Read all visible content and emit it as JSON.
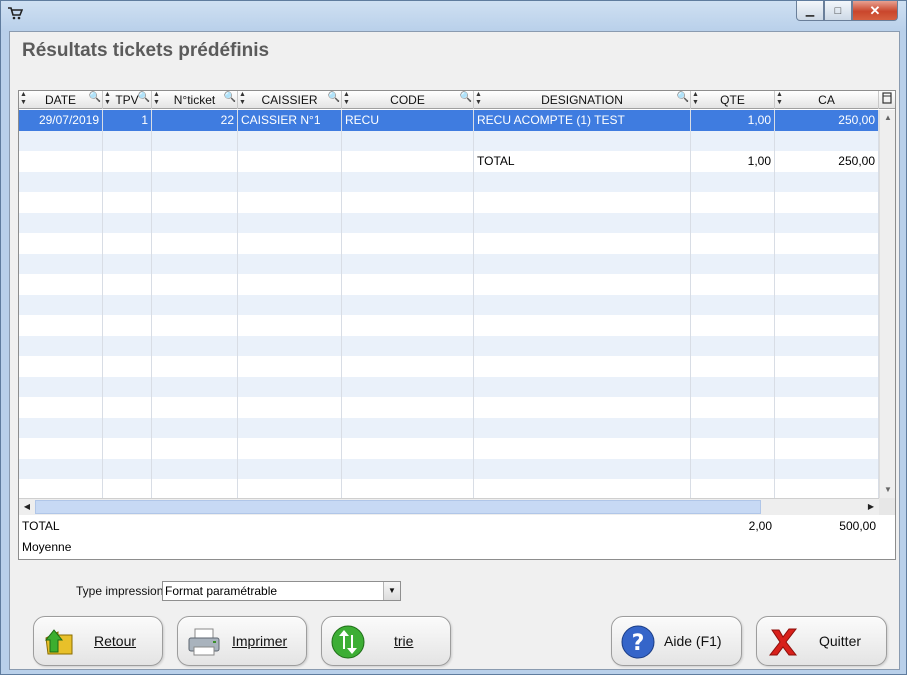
{
  "window": {
    "minimize_glyph": "▁",
    "maximize_glyph": "□",
    "close_glyph": "✕"
  },
  "page_title": "Résultats tickets prédéfinis",
  "table": {
    "columns": [
      "DATE",
      "TPV",
      "N°ticket",
      "CAISSIER",
      "CODE",
      "DESIGNATION",
      "QTE",
      "CA"
    ],
    "rows": [
      {
        "date": "29/07/2019",
        "tpv": "1",
        "ticket": "22",
        "caissier": "CAISSIER N°1",
        "code": "RECU",
        "designation": "RECU ACOMPTE (1) TEST",
        "qte": "1,00",
        "ca": "250,00"
      },
      {
        "date": "",
        "tpv": "",
        "ticket": "",
        "caissier": "",
        "code": "",
        "designation": "",
        "qte": "",
        "ca": ""
      },
      {
        "date": "",
        "tpv": "",
        "ticket": "",
        "caissier": "",
        "code": "",
        "designation": "TOTAL",
        "qte": "1,00",
        "ca": "250,00"
      }
    ],
    "selected_row": 0
  },
  "totals": {
    "total_label": "TOTAL",
    "total_qte": "2,00",
    "total_ca": "500,00",
    "average_label": "Moyenne"
  },
  "print": {
    "type_label": "Type impression",
    "type_value": "Format paramétrable"
  },
  "buttons": {
    "retour": "Retour",
    "imprimer": "Imprimer",
    "trie": "trie",
    "aide": "Aide (F1)",
    "quitter": "Quitter"
  },
  "colors": {
    "selection": "#3f7ce0",
    "alt_row": "#eaf1fa",
    "title_text": "#5b5b5b"
  }
}
